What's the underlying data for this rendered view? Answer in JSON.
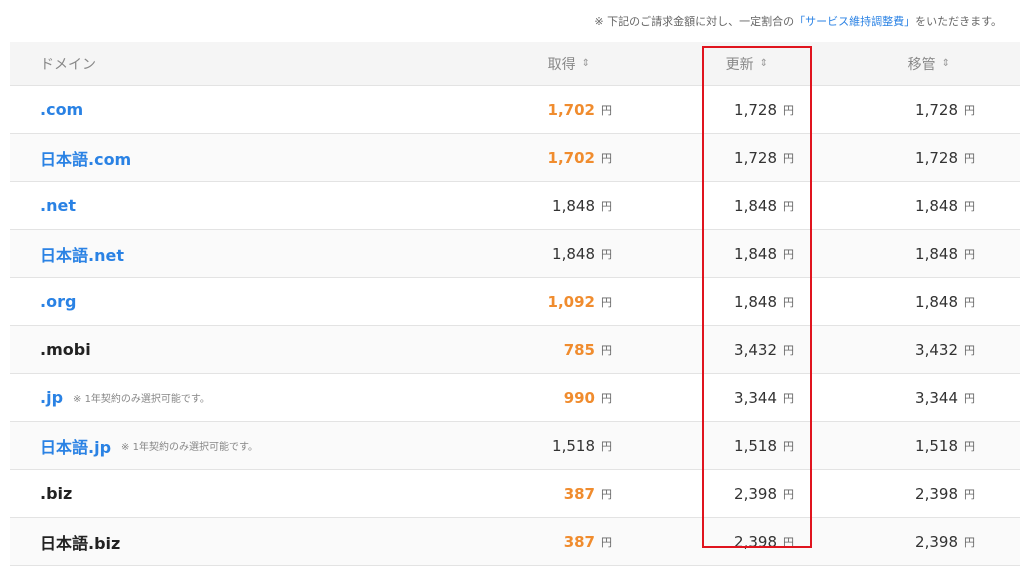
{
  "note": {
    "prefix": "※ 下記のご請求金額に対し、一定割合の",
    "link": "「サービス維持調整費」",
    "suffix": "をいただきます。"
  },
  "header": {
    "domain": "ドメイン",
    "acquire": "取得",
    "renew": "更新",
    "transfer": "移管",
    "sort_glyph": "⇕"
  },
  "unit": "円",
  "rows": [
    {
      "domain": ".com",
      "note": "",
      "acquire": "1,702",
      "renew": "1,728",
      "transfer": "1,728"
    },
    {
      "domain": "日本語.com",
      "note": "",
      "acquire": "1,702",
      "renew": "1,728",
      "transfer": "1,728"
    },
    {
      "domain": ".net",
      "note": "",
      "acquire": "1,848",
      "renew": "1,848",
      "transfer": "1,848"
    },
    {
      "domain": "日本語.net",
      "note": "",
      "acquire": "1,848",
      "renew": "1,848",
      "transfer": "1,848"
    },
    {
      "domain": ".org",
      "note": "",
      "acquire": "1,092",
      "renew": "1,848",
      "transfer": "1,848"
    },
    {
      "domain": ".mobi",
      "note": "",
      "acquire": "785",
      "renew": "3,432",
      "transfer": "3,432"
    },
    {
      "domain": ".jp",
      "note": "※ 1年契約のみ選択可能です。",
      "acquire": "990",
      "renew": "3,344",
      "transfer": "3,344"
    },
    {
      "domain": "日本語.jp",
      "note": "※ 1年契約のみ選択可能です。",
      "acquire": "1,518",
      "renew": "1,518",
      "transfer": "1,518"
    },
    {
      "domain": ".biz",
      "note": "",
      "acquire": "387",
      "renew": "2,398",
      "transfer": "2,398"
    },
    {
      "domain": "日本語.biz",
      "note": "",
      "acquire": "387",
      "renew": "2,398",
      "transfer": "2,398"
    }
  ],
  "colors": {
    "link_blue": "#2a82e4",
    "discount_orange": "#f08c2e",
    "highlight_red": "#e0141e"
  }
}
